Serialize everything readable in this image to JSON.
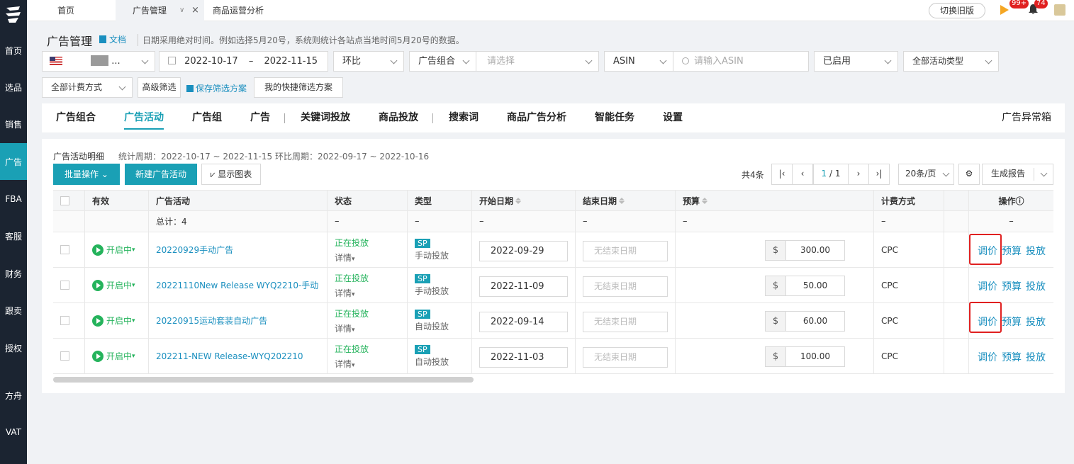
{
  "sidebar": {
    "items": [
      {
        "label": "首页"
      },
      {
        "label": "选品"
      },
      {
        "label": "销售"
      },
      {
        "label": "广告"
      },
      {
        "label": "FBA"
      },
      {
        "label": "客服"
      },
      {
        "label": "财务"
      },
      {
        "label": "跟卖"
      },
      {
        "label": "授权"
      },
      {
        "label": "方舟"
      },
      {
        "label": "VAT"
      }
    ],
    "active_index": 3
  },
  "topbar": {
    "tabs": [
      {
        "label": "首页"
      },
      {
        "label": "广告管理"
      },
      {
        "label": "商品运营分析"
      }
    ],
    "close_glyph": "×",
    "old_version_label": "切换旧版",
    "flag_badge": "99+",
    "bell_badge": "74"
  },
  "header": {
    "title": "广告管理",
    "doc_label": "文档",
    "note": "日期采用绝对时间。例如选择5月20号，系统则统计各站点当地时间5月20号的数据。"
  },
  "filters": {
    "store_suffix": "...",
    "date_start": "2022-10-17",
    "date_sep": "–",
    "date_end": "2022-11-15",
    "compare": "环比",
    "group_type": "广告组合",
    "group_placeholder": "请选择",
    "asin_type": "ASIN",
    "asin_placeholder": "请输入ASIN",
    "status": "已启用",
    "campaign_type": "全部活动类型",
    "billing": "全部计费方式",
    "advanced_label": "高级筛选",
    "save_label": "保存筛选方案",
    "my_plans_label": "我的快捷筛选方案"
  },
  "subtabs": {
    "items": [
      "广告组合",
      "广告活动",
      "广告组",
      "广告",
      "关键词投放",
      "商品投放",
      "搜索词",
      "商品广告分析",
      "智能任务",
      "设置"
    ],
    "active": "广告活动",
    "right_label": "广告异常箱"
  },
  "section": {
    "title": "广告活动明细",
    "stat": "统计周期：2022-10-17 ~ 2022-11-15  环比周期：2022-09-17 ~ 2022-10-16",
    "bulk_label": "批量操作",
    "new_label": "新建广告活动",
    "chart_label": "显示图表",
    "total_label": "共4条",
    "page_current": "1",
    "page_total": "/ 1",
    "page_size": "20条/页",
    "report_label": "生成报告"
  },
  "table": {
    "headers": {
      "valid": "有效",
      "campaign": "广告活动",
      "status": "状态",
      "type": "类型",
      "start": "开始日期",
      "end": "结束日期",
      "budget": "预算",
      "billing": "计费方式",
      "ops": "操作ⓘ"
    },
    "total_row": {
      "campaign": "总计：4",
      "dash": "–"
    },
    "end_placeholder": "无结束日期",
    "currency": "$",
    "detail_label": "详情",
    "ops": [
      "调价",
      "预算",
      "投放"
    ],
    "rows": [
      {
        "valid": "开启中",
        "campaign": "20220929手动广告",
        "status": "正在投放",
        "type_tag": "SP",
        "type": "手动投放",
        "start": "2022-09-29",
        "budget": "300.00",
        "billing": "CPC"
      },
      {
        "valid": "开启中",
        "campaign": "20221110New Release WYQ2210-手动",
        "status": "正在投放",
        "type_tag": "SP",
        "type": "手动投放",
        "start": "2022-11-09",
        "budget": "50.00",
        "billing": "CPC"
      },
      {
        "valid": "开启中",
        "campaign": "20220915运动套装自动广告",
        "status": "正在投放",
        "type_tag": "SP",
        "type": "自动投放",
        "start": "2022-09-14",
        "budget": "60.00",
        "billing": "CPC"
      },
      {
        "valid": "开启中",
        "campaign": "202211-NEW Release-WYQ202210",
        "status": "正在投放",
        "type_tag": "SP",
        "type": "自动投放",
        "start": "2022-11-03",
        "budget": "100.00",
        "billing": "CPC"
      }
    ]
  },
  "colors": {
    "accent": "#1aa0b5",
    "link": "#1a8fbf",
    "success": "#25b35c",
    "highlight": "#e02020",
    "sidebar": "#1b2431"
  }
}
